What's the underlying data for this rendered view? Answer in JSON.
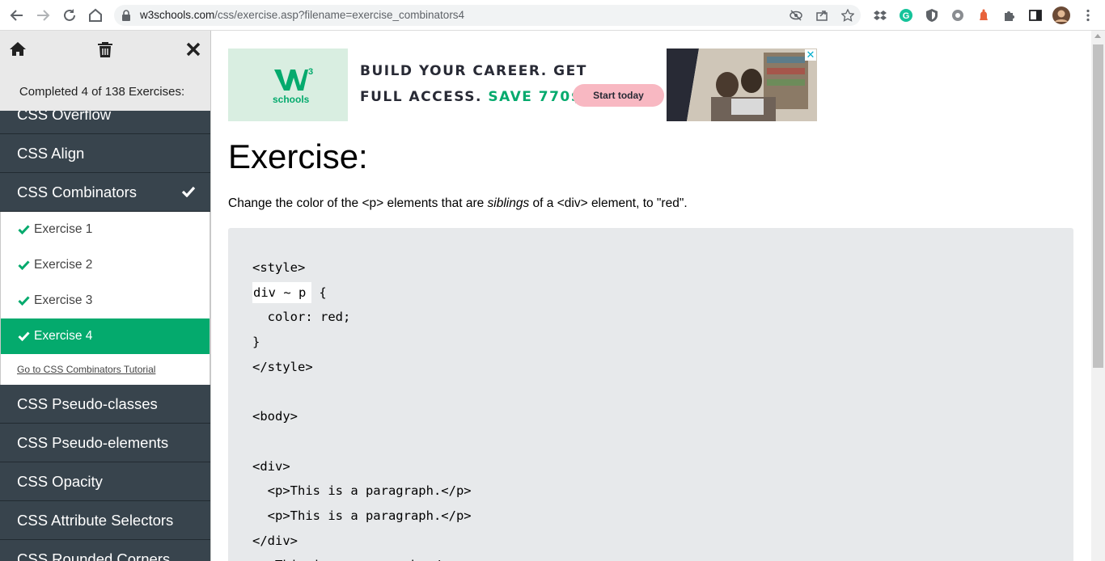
{
  "browser": {
    "url_host": "w3schools.com",
    "url_path": "/css/exercise.asp?filename=exercise_combinators4"
  },
  "sidebar": {
    "progress_text": "Completed 4 of 138 Exercises:",
    "topics_before": [
      {
        "label": "CSS Overflow"
      },
      {
        "label": "CSS Align"
      }
    ],
    "current_topic": {
      "label": "CSS Combinators"
    },
    "exercises": [
      {
        "label": "Exercise 1"
      },
      {
        "label": "Exercise 2"
      },
      {
        "label": "Exercise 3"
      },
      {
        "label": "Exercise 4"
      }
    ],
    "tutorial_link": "Go to CSS Combinators Tutorial",
    "topics_after": [
      {
        "label": "CSS Pseudo-classes"
      },
      {
        "label": "CSS Pseudo-elements"
      },
      {
        "label": "CSS Opacity"
      },
      {
        "label": "CSS Attribute Selectors"
      },
      {
        "label": "CSS Rounded Corners"
      }
    ]
  },
  "ad": {
    "logo_text": "schools",
    "line1": "BUILD YOUR CAREER. GET",
    "line2_prefix": "FULL ACCESS.",
    "line2_highlight": "SAVE 770$",
    "cta": "Start today",
    "close": "✕"
  },
  "exercise": {
    "title": "Exercise:",
    "instruction_before": "Change the color of the <p> elements that are ",
    "instruction_em": "siblings",
    "instruction_after": " of a <div> element, to \"red\".",
    "code_lines": [
      "<style>",
      "",
      "  color: red;",
      "}",
      "</style>",
      "",
      "<body>",
      "",
      "<div>",
      "  <p>This is a paragraph.</p>",
      "  <p>This is a paragraph.</p>",
      "</div>",
      "<p>This is a paragraph.</p>"
    ],
    "input_value": "div ~ p",
    "input_suffix": " {"
  },
  "colors": {
    "sidebar_dark": "#38444d",
    "active_green": "#04aa6d",
    "code_bg": "#e7e9eb"
  }
}
